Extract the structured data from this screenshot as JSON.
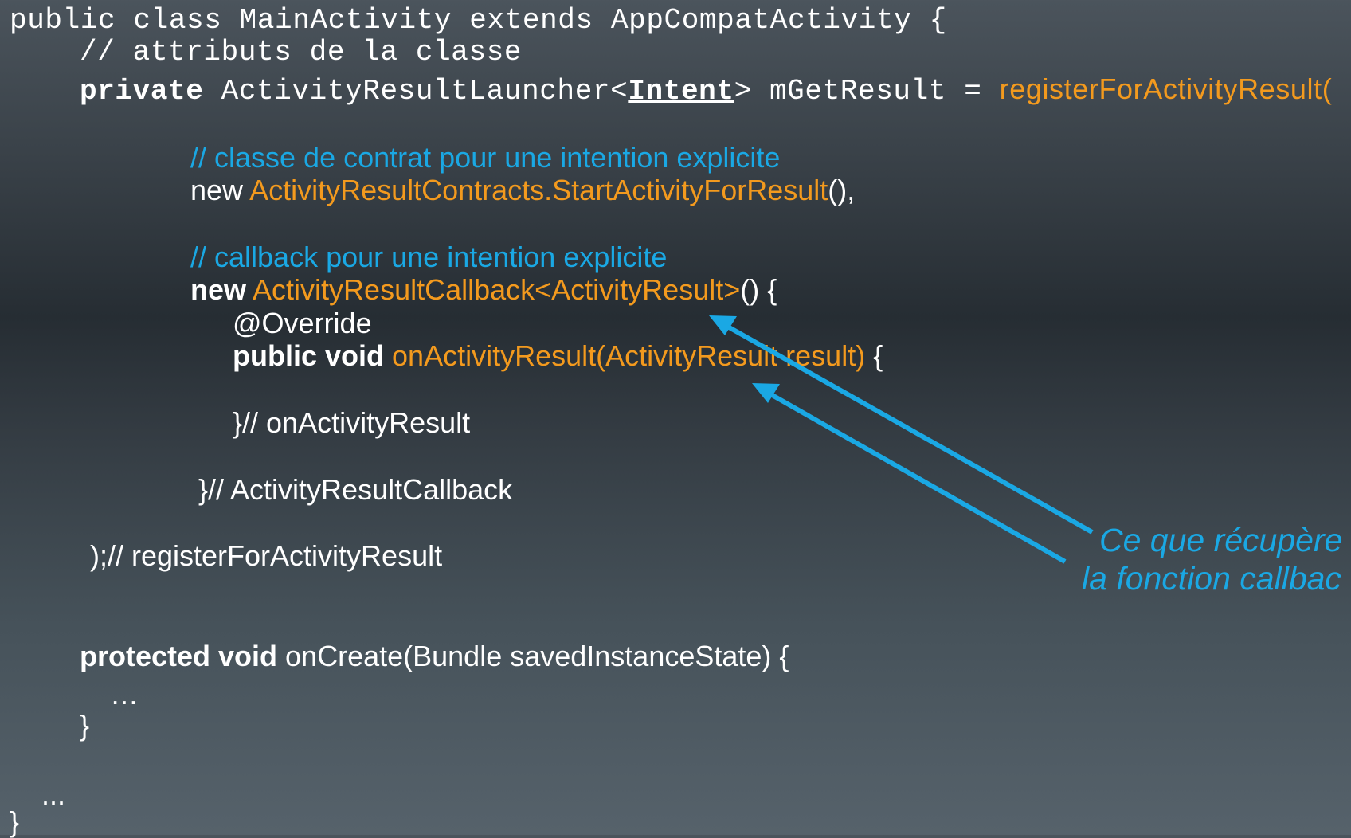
{
  "colors": {
    "keyword": "#ffffff",
    "api": "#f39a1e",
    "comment": "#1aa8e4",
    "annotation": "#1aa8e4"
  },
  "code": {
    "l1": "public class MainActivity extends AppCompatActivity {",
    "l2": "// attributs de la classe",
    "l3": {
      "kw": "private",
      "type_start": " ActivityResultLauncher<",
      "type_param": "Intent",
      "rest": "> mGetResult = ",
      "call": "registerForActivityResult("
    },
    "comment1": "// classe de contrat pour une intention explicite",
    "l5": {
      "new": "new ",
      "contract": "ActivityResultContracts.StartActivityForResult",
      "tail": "(),"
    },
    "comment2": "// callback pour une intention explicite",
    "l7": {
      "new": "new",
      "callback": "ActivityResultCallback<ActivityResult>",
      "tail": "() {"
    },
    "override": "@Override",
    "l9": {
      "kw": "public void",
      "method": "onActivityResult(ActivityResult result)",
      "tail": " {"
    },
    "end_method": "}// onActivityResult",
    "end_callback": "}// ActivityResultCallback",
    "end_register": ");// registerForActivityResult",
    "l13": {
      "kw": "protected void",
      "rest": " onCreate(Bundle savedInstanceState) {"
    },
    "ellipsis_inner": "…",
    "close_inner": "}",
    "ellipsis_outer": "...",
    "close_outer": "}"
  },
  "annotation": {
    "line1": "Ce que récupère",
    "line2": "la fonction callbac",
    "arrow_icon": "arrow-icon"
  }
}
